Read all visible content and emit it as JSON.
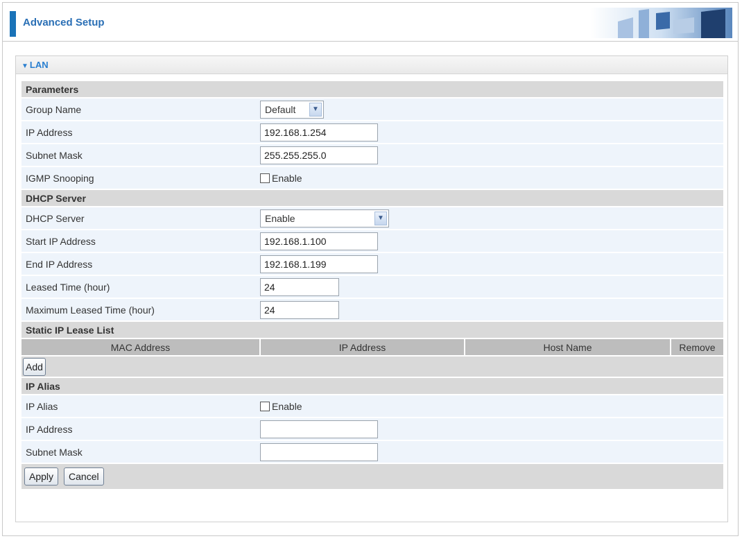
{
  "header": {
    "title": "Advanced Setup"
  },
  "panel": {
    "title": "LAN"
  },
  "parameters": {
    "section_label": "Parameters",
    "group_name": {
      "label": "Group Name",
      "value": "Default"
    },
    "ip_address": {
      "label": "IP Address",
      "value": "192.168.1.254"
    },
    "subnet_mask": {
      "label": "Subnet Mask",
      "value": "255.255.255.0"
    },
    "igmp_snooping": {
      "label": "IGMP Snooping",
      "checkbox_label": "Enable",
      "checked": false
    }
  },
  "dhcp": {
    "section_label": "DHCP Server",
    "dhcp_server": {
      "label": "DHCP Server",
      "value": "Enable"
    },
    "start_ip": {
      "label": "Start IP Address",
      "value": "192.168.1.100"
    },
    "end_ip": {
      "label": "End IP Address",
      "value": "192.168.1.199"
    },
    "leased_time": {
      "label": "Leased Time (hour)",
      "value": "24"
    },
    "max_leased_time": {
      "label": "Maximum Leased Time (hour)",
      "value": "24"
    }
  },
  "lease_list": {
    "section_label": "Static IP Lease List",
    "columns": [
      "MAC Address",
      "IP Address",
      "Host Name",
      "Remove"
    ],
    "add_label": "Add"
  },
  "ip_alias": {
    "section_label": "IP Alias",
    "alias": {
      "label": "IP Alias",
      "checkbox_label": "Enable",
      "checked": false
    },
    "ip_address": {
      "label": "IP Address",
      "value": ""
    },
    "subnet_mask": {
      "label": "Subnet Mask",
      "value": ""
    }
  },
  "actions": {
    "apply_label": "Apply",
    "cancel_label": "Cancel"
  },
  "colors": {
    "accent": "#1a73b8",
    "section_bg": "#d9d9d9",
    "field_bg": "#eef4fb",
    "panel_title": "#2a7fd0"
  }
}
